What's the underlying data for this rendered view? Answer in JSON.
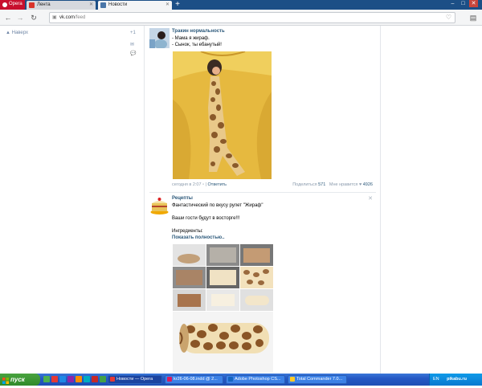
{
  "browser": {
    "menu_label": "Opera",
    "tabs": [
      {
        "label": "Лента"
      },
      {
        "label": "Новости"
      }
    ],
    "new_tab_label": "+",
    "url_host": "vk.com",
    "url_path": "/feed"
  },
  "sidebar": {
    "scroll_top_label": "▲ Наверх",
    "icons": [
      "+1",
      "✉",
      "💬"
    ]
  },
  "posts": [
    {
      "author": "Тракин нормальность",
      "lines": [
        "- Мама я жираф.",
        "- Сынок, ты ебанутый!"
      ],
      "meta_time": "сегодня в 2:07",
      "meta_reply": "Ответить",
      "share_label": "Поделиться",
      "share_count": "571",
      "like_label": "Мне нравится",
      "like_count": "4926"
    },
    {
      "author": "Рецепты",
      "lines": [
        "Фантастический по вкусу рулет \"Жираф\"",
        "",
        "Ваши гости будут в восторге!!!",
        "",
        "Ингредиенты:"
      ],
      "show_more": "Показать полностью..",
      "close": "✕"
    }
  ],
  "taskbar": {
    "start_label": "пуск",
    "items": [
      {
        "label": "Новости — Opera"
      },
      {
        "label": "kr26-06-08.indd @ 2..."
      },
      {
        "label": "Adobe Photoshop CS..."
      },
      {
        "label": "Total Commander 7.0..."
      }
    ],
    "tray_lang": "EN",
    "watermark": "pikabu.ru"
  },
  "colors": {
    "link": "#2b587a",
    "tabstrip": "#1c4f86",
    "opera_red": "#c8102e"
  }
}
